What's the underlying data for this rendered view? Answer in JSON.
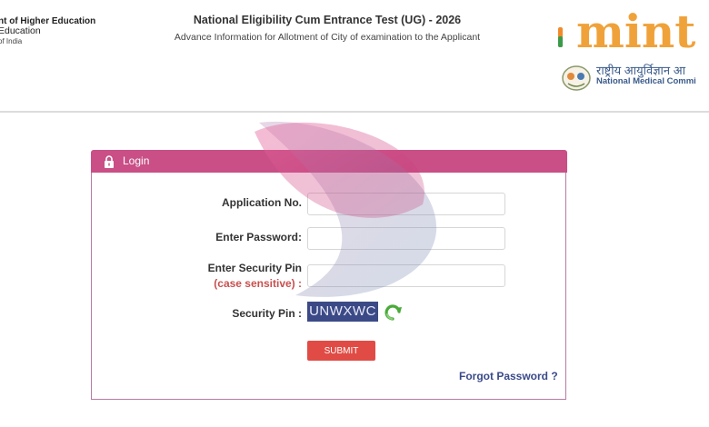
{
  "header": {
    "ministry_line1": "nt of Higher Education",
    "ministry_line2": "Education",
    "ministry_line3": "of India",
    "title": "National Eligibility Cum Entrance Test (UG) - 2026",
    "subtitle": "Advance Information for Allotment of City of examination to the Applicant",
    "brand": "mint",
    "nmc_hindi": "राष्ट्रीय आयुर्विज्ञान आ",
    "nmc_english": "National Medical Commi"
  },
  "login": {
    "panel_title": "Login",
    "application_label": "Application No.",
    "application_value": "",
    "password_label": "Enter Password:",
    "password_value": "",
    "security_pin_label": "Enter Security Pin",
    "security_pin_note": "(case sensitive) :",
    "security_pin_value": "",
    "captcha_label": "Security Pin :",
    "captcha_text": "UNWXWC",
    "submit_label": "SUBMIT",
    "forgot_label": "Forgot Password ?"
  },
  "colors": {
    "panel_header": "#c94f86",
    "panel_border": "#b77ba0",
    "submit": "#e04c45",
    "captcha_bg": "#3b4a86",
    "link": "#3a4a8a",
    "brand": "#f0a23a"
  },
  "icons": [
    "lock-icon",
    "refresh-icon",
    "emblem-icon"
  ]
}
